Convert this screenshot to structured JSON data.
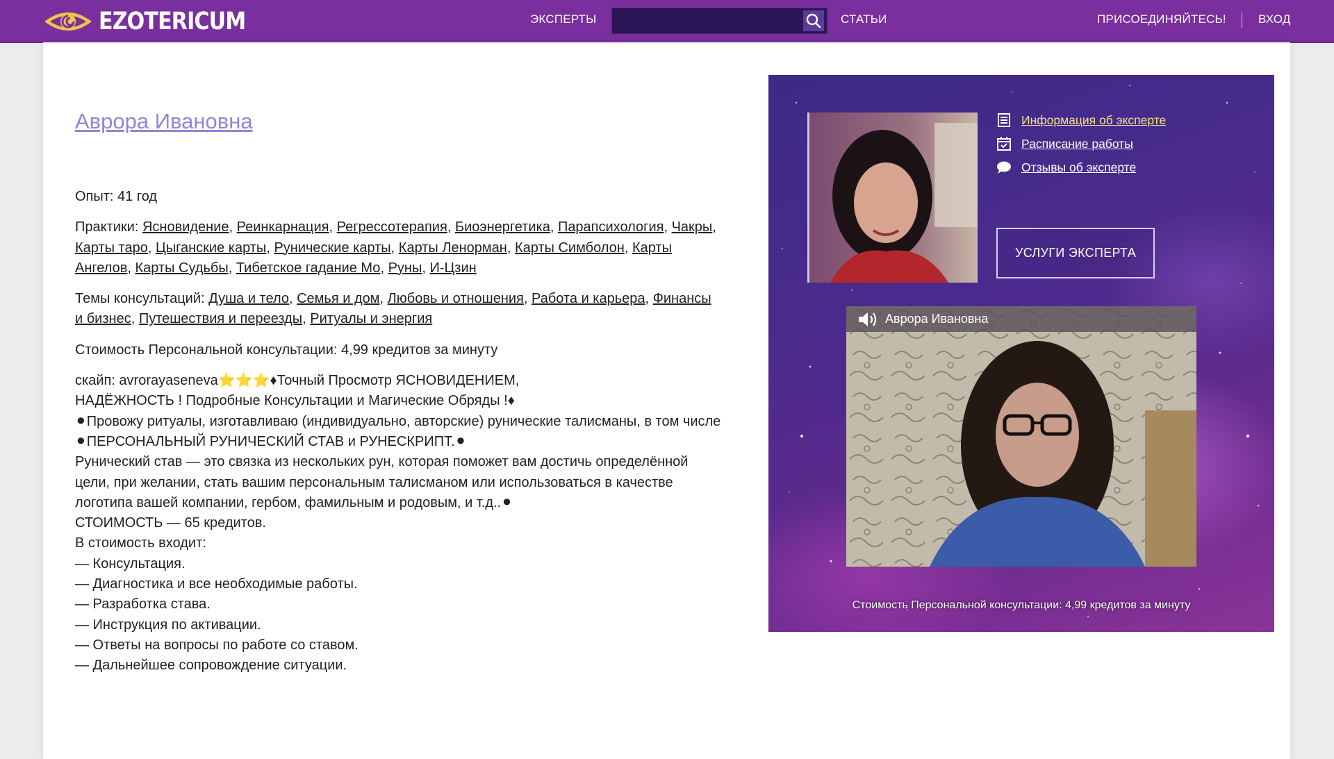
{
  "header": {
    "logo_text": "EZOTERICUM",
    "nav_experts": "ЭКСПЕРТЫ",
    "search_placeholder": "",
    "nav_articles": "СТАТЬИ",
    "nav_join": "ПРИСОЕДИНЯЙТЕСЬ!",
    "nav_login": "ВХОД",
    "colors": {
      "bar": "#7a2f9e",
      "search_bg": "#2c1557",
      "logo_eye": "#f2c24a"
    }
  },
  "expert": {
    "name": "Аврора Ивановна",
    "experience": "Опыт: 41 год",
    "practices_label": "Практики: ",
    "practices": [
      "Ясновидение",
      "Реинкарнация",
      "Регрессотерапия",
      "Биоэнергетика",
      "Парапсихология",
      "Чакры",
      "Карты таро",
      "Цыганские карты",
      "Рунические карты",
      "Карты Ленорман",
      "Карты Симболон",
      "Карты Ангелов",
      "Карты Судьбы",
      "Тибетское гадание Мо",
      "Руны",
      "И-Цзин"
    ],
    "topics_label": "Темы консультаций: ",
    "topics": [
      "Душа и тело",
      "Семья и дом",
      "Любовь и отношения",
      "Работа и карьера",
      "Финансы и бизнес",
      "Путешествия и переезды",
      "Ритуалы и энергия"
    ],
    "price_line": "Стоимость Персональной консультации: 4,99 кредитов за минуту",
    "description": [
      "скайп: avrorayaseneva⭐⭐⭐♦Точный Просмотр ЯСНОВИДЕНИЕМ,",
      "НАДЁЖНОСТЬ ! Подробные Консультации и Магические Обряды !♦",
      "⚫Провожу ритуалы, изготавливаю (индивидуально, авторские) рунические талисманы, в том числе",
      "⚫ПЕРСОНАЛЬНЫЙ РУНИЧЕСКИЙ СТАВ и РУНЕСКРИПТ.⚫",
      "Рунический став — это связка из нескольких рун, которая поможет вам достичь определённой цели, при желании, стать вашим персональным талисманом или использоваться в качестве логотипа вашей компании, гербом, фамильным и родовым, и т.д..⚫",
      "СТОИМОСТЬ — 65 кредитов.",
      "В стоимость входит:",
      "— Консультация.",
      "— Диагностика и все необходимые работы.",
      "— Разработка става.",
      "— Инструкция по активации.",
      "— Ответы на вопросы по работе со ставом.",
      "— Дальнейшее сопровождение ситуации."
    ]
  },
  "panel": {
    "links": [
      {
        "label": "Информация об эксперте",
        "icon": "document-icon",
        "active": true
      },
      {
        "label": "Расписание работы",
        "icon": "calendar-icon",
        "active": false
      },
      {
        "label": "Отзывы об эксперте",
        "icon": "speech-bubble-icon",
        "active": false
      }
    ],
    "services_button": "УСЛУГИ ЭКСПЕРТА",
    "video_title": "Аврора Ивановна",
    "price": "Стоимость Персональной консультации: 4,99 кредитов за минуту",
    "colors": {
      "active_link": "#f6e08a"
    }
  }
}
